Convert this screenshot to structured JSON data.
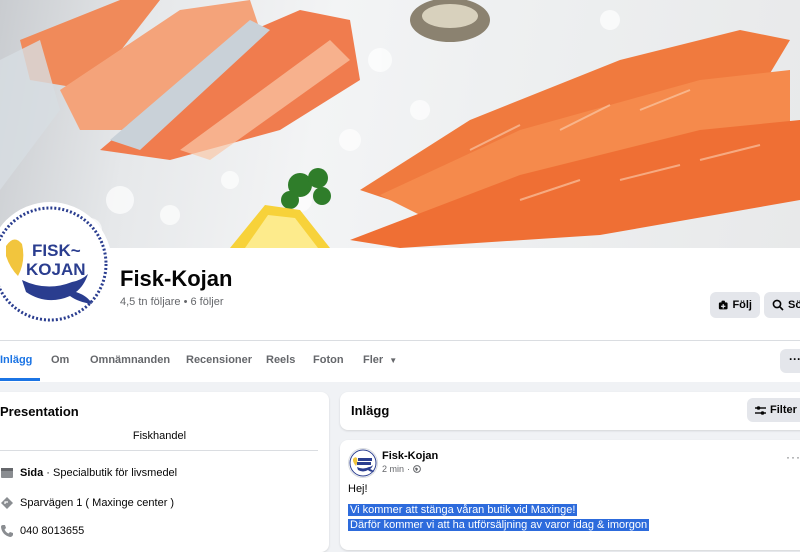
{
  "page": {
    "name": "Fisk-Kojan",
    "stats": "4,5 tn följare • 6 följer",
    "logo_text_line1": "FISK~",
    "logo_text_line2": "KOJAN"
  },
  "actions": {
    "follow_label": "Följ",
    "search_label": "Sö"
  },
  "tabs": [
    {
      "label": "Inlägg"
    },
    {
      "label": "Om"
    },
    {
      "label": "Omnämnanden"
    },
    {
      "label": "Recensioner"
    },
    {
      "label": "Reels"
    },
    {
      "label": "Foton"
    },
    {
      "label": "Fler"
    }
  ],
  "more_label": "···",
  "intro": {
    "title": "Presentation",
    "category": "Fiskhandel",
    "page_type_bold": "Sida",
    "page_type_rest": " · Specialbutik för livsmedel",
    "address": "Sparvägen 1 ( Maxinge center )",
    "phone": "040 8013655"
  },
  "posts": {
    "title": "Inlägg",
    "filter_label": "Filter"
  },
  "post": {
    "author": "Fisk-Kojan",
    "time": "2 min",
    "greeting": "Hej!",
    "line1": "Vi kommer att stänga våran butik vid Maxinge!",
    "line2": "Därför kommer vi att ha utförsäljning av varor idag & imorgon",
    "menu": "···"
  },
  "colors": {
    "accent": "#1b74e4",
    "highlight": "#2d6bdc",
    "logo_navy": "#2a3d8f",
    "logo_yellow": "#f2c53d"
  }
}
